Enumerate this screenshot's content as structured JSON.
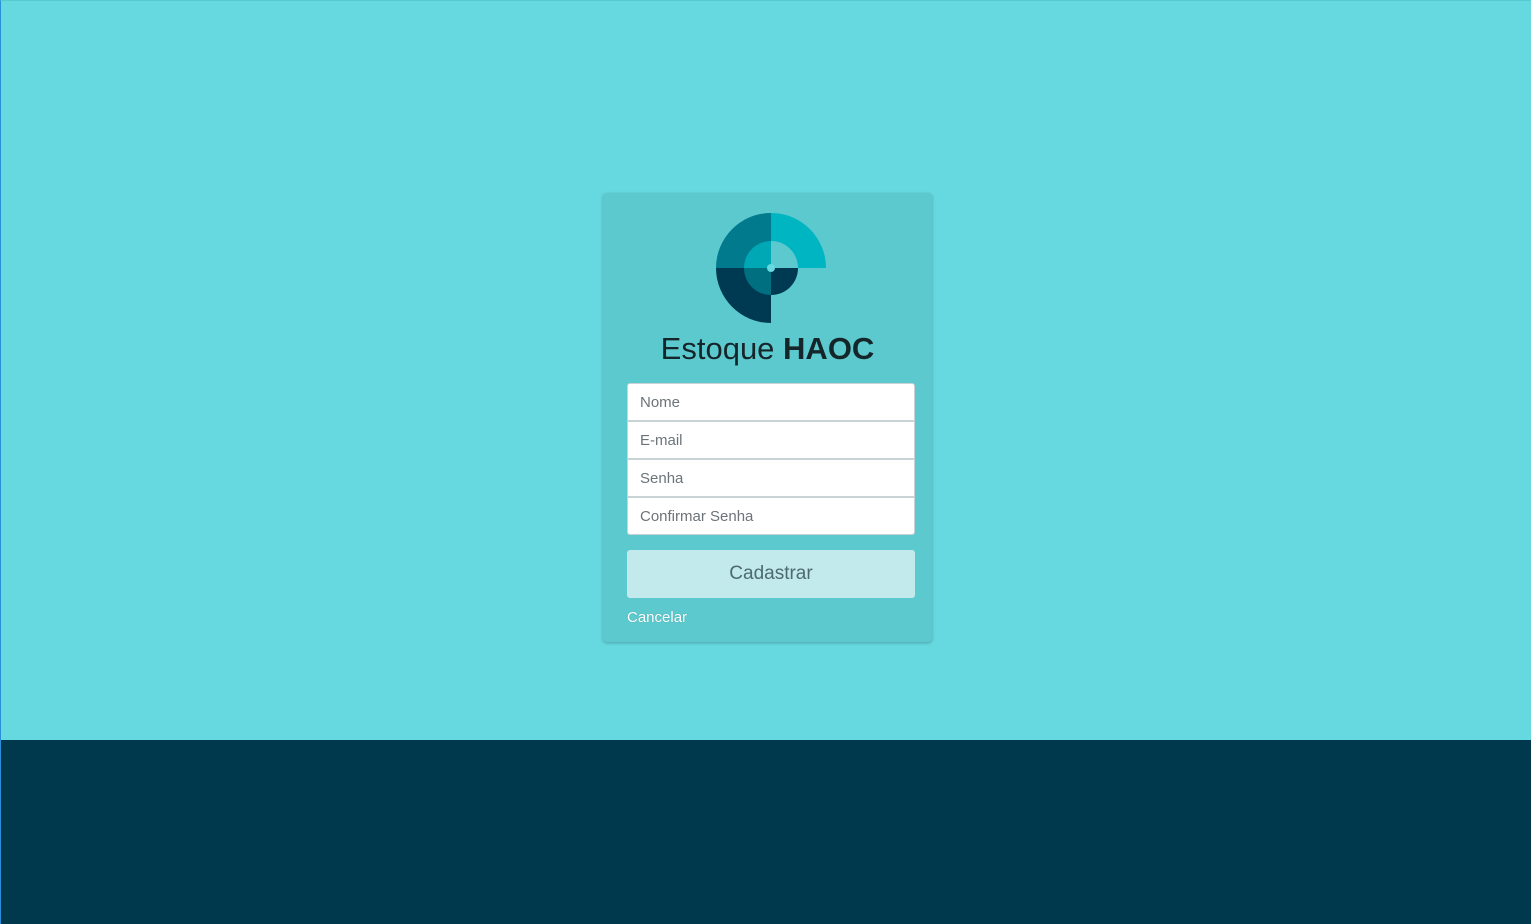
{
  "brand": {
    "name_regular": "Estoque ",
    "name_bold": "HAOC"
  },
  "form": {
    "name_placeholder": "Nome",
    "email_placeholder": "E-mail",
    "password_placeholder": "Senha",
    "confirm_password_placeholder": "Confirmar Senha",
    "submit_label": "Cadastrar",
    "cancel_label": "Cancelar"
  },
  "colors": {
    "background": "#66d9e0",
    "footer": "#00394d",
    "card": "#5cc9ce",
    "logo_dark": "#003a52",
    "logo_mid": "#007a8c",
    "logo_light": "#00b5c2",
    "button": "#c2e9ec"
  },
  "icons": {
    "logo": "haoc-spiral-logo"
  }
}
